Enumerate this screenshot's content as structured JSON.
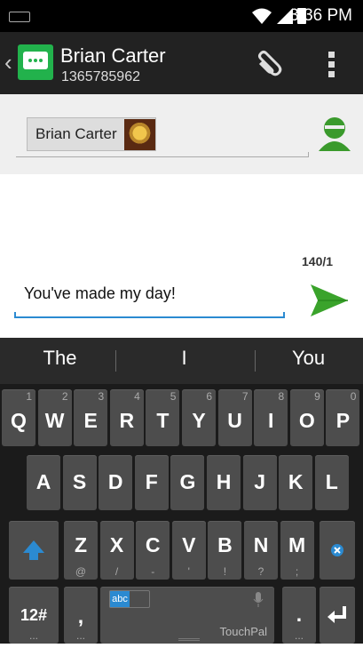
{
  "status_bar": {
    "time": "3:36 PM"
  },
  "header": {
    "contact_name": "Brian Carter",
    "phone": "1365785962"
  },
  "recipients": [
    {
      "name": "Brian Carter"
    }
  ],
  "compose": {
    "counter": "140/1",
    "message": "You've made my day!"
  },
  "keyboard": {
    "suggestions": [
      "The",
      "I",
      "You"
    ],
    "row1": [
      {
        "k": "Q",
        "h": "1"
      },
      {
        "k": "W",
        "h": "2"
      },
      {
        "k": "E",
        "h": "3"
      },
      {
        "k": "R",
        "h": "4"
      },
      {
        "k": "T",
        "h": "5"
      },
      {
        "k": "Y",
        "h": "6"
      },
      {
        "k": "U",
        "h": "7"
      },
      {
        "k": "I",
        "h": "8"
      },
      {
        "k": "O",
        "h": "9"
      },
      {
        "k": "P",
        "h": "0"
      }
    ],
    "row2": [
      "A",
      "S",
      "D",
      "F",
      "G",
      "H",
      "J",
      "K",
      "L"
    ],
    "row3": [
      {
        "k": "Z",
        "s": "@"
      },
      {
        "k": "X",
        "s": "/"
      },
      {
        "k": "C",
        "s": "-"
      },
      {
        "k": "V",
        "s": "'"
      },
      {
        "k": "B",
        "s": "!"
      },
      {
        "k": "N",
        "s": "?"
      },
      {
        "k": "M",
        "s": ";"
      }
    ],
    "mode_key": "12#",
    "comma_key": ",",
    "period_key": ".",
    "more": "...",
    "space_badge": "abc",
    "space_brand": "TouchPal"
  },
  "colors": {
    "accent_green": "#22b24c",
    "accent_blue": "#2b8ad1",
    "keyboard_bg": "#1b1b1b",
    "key_bg": "#4d4d4d"
  },
  "icons": [
    "keyboard-indicator-icon",
    "wifi-icon",
    "signal-icon",
    "battery-icon",
    "back-chevron-icon",
    "messaging-app-icon",
    "paperclip-icon",
    "overflow-menu-icon",
    "contact-person-icon",
    "send-icon",
    "shift-icon",
    "delete-icon",
    "microphone-icon",
    "enter-icon"
  ]
}
